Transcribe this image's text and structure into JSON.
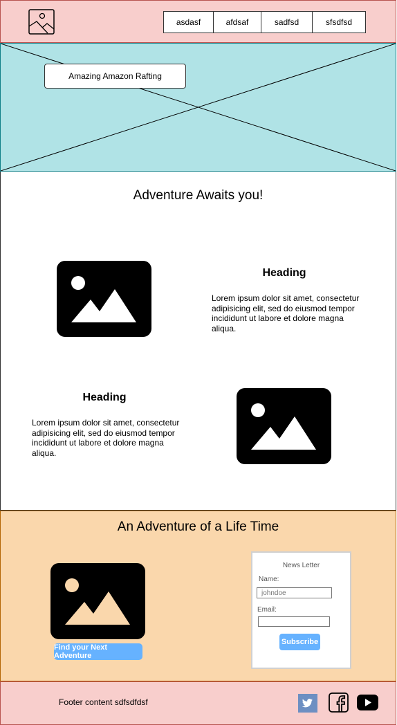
{
  "header": {
    "logo_icon": "image-placeholder-icon",
    "nav": [
      {
        "label": "asdasf"
      },
      {
        "label": "afdsaf"
      },
      {
        "label": "sadfsd"
      },
      {
        "label": "sfsdfsd"
      }
    ]
  },
  "hero": {
    "title": "Amazing Amazon Rafting",
    "background_icon": "image-placeholder-cross"
  },
  "main": {
    "title": "Adventure Awaits you!",
    "features": [
      {
        "heading": "Heading",
        "text": "Lorem ipsum dolor sit amet, consectetur adipisicing elit, sed do eiusmod tempor incididunt ut labore et dolore magna aliqua.",
        "image_icon": "image-icon"
      },
      {
        "heading": "Heading",
        "text": "Lorem ipsum dolor sit amet, consectetur adipisicing elit, sed do eiusmod tempor incididunt ut labore et dolore magna aliqua.",
        "image_icon": "image-icon"
      }
    ]
  },
  "promo": {
    "title": "An Adventure of a Life Time",
    "cta_label": "Find your Next Adventure",
    "newsletter": {
      "title": "News Letter",
      "name_label": "Name:",
      "name_placeholder": "johndoe",
      "email_label": "Email:",
      "email_value": "",
      "subscribe_label": "Subscribe"
    }
  },
  "footer": {
    "text": "Footer content sdfsdfdsf",
    "social": [
      {
        "icon": "twitter-icon"
      },
      {
        "icon": "facebook-icon"
      },
      {
        "icon": "youtube-icon"
      }
    ]
  },
  "colors": {
    "header_bg": "#f8cecc",
    "hero_bg": "#b0e3e6",
    "promo_bg": "#fad7ac",
    "button_blue": "#66b2ff",
    "twitter_blue": "#6d8fc2"
  }
}
